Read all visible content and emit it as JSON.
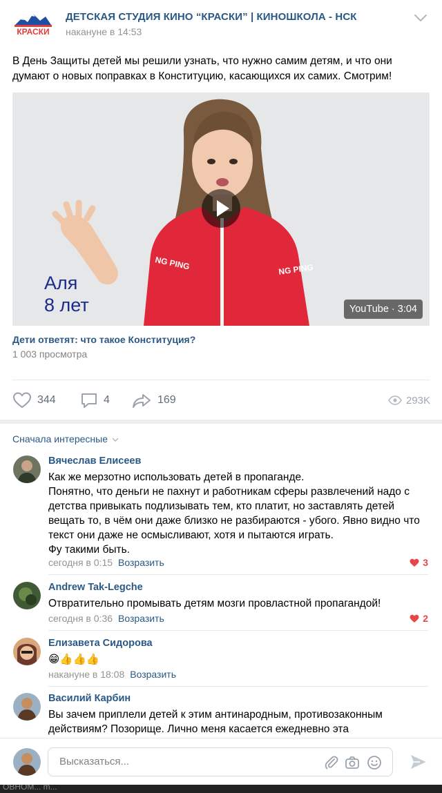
{
  "post": {
    "group_name": "ДЕТСКАЯ СТУДИЯ КИНО “КРАСКИ” | КИНОШКОЛА - НСК",
    "logo_text": "КРАСКИ",
    "date": "накануне в 14:53",
    "text": "В День Защиты детей мы решили узнать, что нужно самим детям, и что они думают о новых поправках в Конституцию, касающихся их самих. Смотрим!",
    "video": {
      "caption_name": "Аля",
      "caption_age": "8 лет",
      "jersey_text": "NG PING",
      "badge": "YouTube · 3:04",
      "title": "Дети ответят: что такое Конституция?",
      "views": "1 003 просмотра"
    },
    "actions": {
      "likes": "344",
      "comments": "4",
      "shares": "169",
      "views": "293K"
    }
  },
  "comments_section": {
    "sort_label": "Сначала интересные",
    "reply_label": "Возразить",
    "items": [
      {
        "author": "Вячеслав Елисеев",
        "text": "Как же мерзотно использовать детей в пропаганде.\nПонятно, что деньги не пахнут и работникам сферы развлечений надо с детства привыкать подлизывать тем, кто платит, но заставлять детей вещать то, в чём они даже близко не разбираются - убого. Явно видно что текст они даже не осмысливают, хотя и пытаются играть.\nФу такими быть.",
        "date": "сегодня в 0:15",
        "likes": "3"
      },
      {
        "author": "Andrew Tak-Legche",
        "text": "Отвратительно промывать детям мозги провластной пропагандой!",
        "date": "сегодня в 0:36",
        "likes": "2"
      },
      {
        "author": "Елизавета Сидорова",
        "text": "😁👍👍👍",
        "date": "накануне в 18:08",
        "likes": ""
      },
      {
        "author": "Василий Карбин",
        "text": "Вы зачем приплели детей к этим антинародным, противозаконным действиям? Позорище. Лично меня касается ежедневно эта",
        "date": "",
        "likes": ""
      }
    ]
  },
  "composer": {
    "placeholder": "Высказаться..."
  },
  "bottom_strip_text": "ОВНОМ... m...",
  "colors": {
    "link": "#2a5885",
    "muted": "#939393",
    "like_red": "#e64646",
    "divider": "#e7e8ec",
    "jacket_red": "#e0283a"
  }
}
